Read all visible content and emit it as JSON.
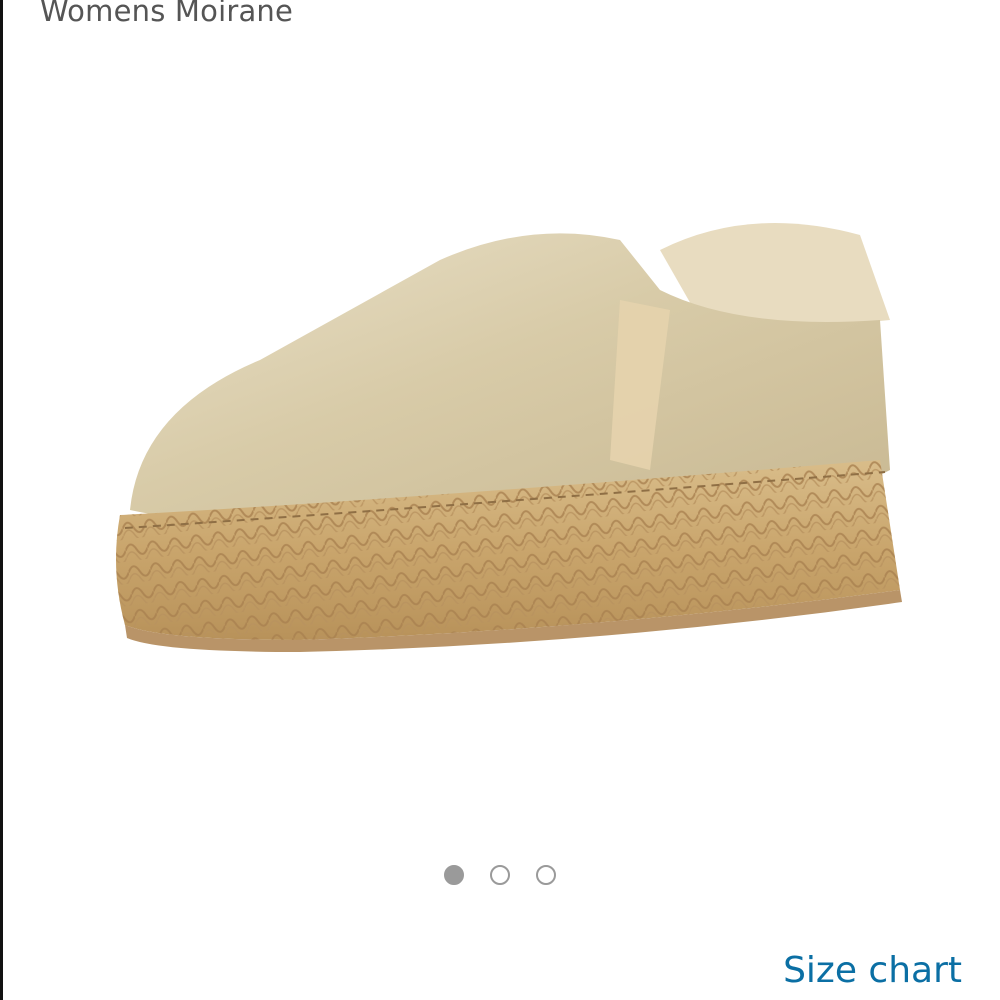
{
  "product": {
    "title": "Womens Moirane",
    "image_alt": "shoe-image"
  },
  "carousel": {
    "count": 3,
    "active_index": 0
  },
  "links": {
    "size_chart": "Size chart"
  },
  "colors": {
    "link": "#0b6fa4",
    "title_text": "#555555",
    "dot": "#9a9a9a"
  }
}
